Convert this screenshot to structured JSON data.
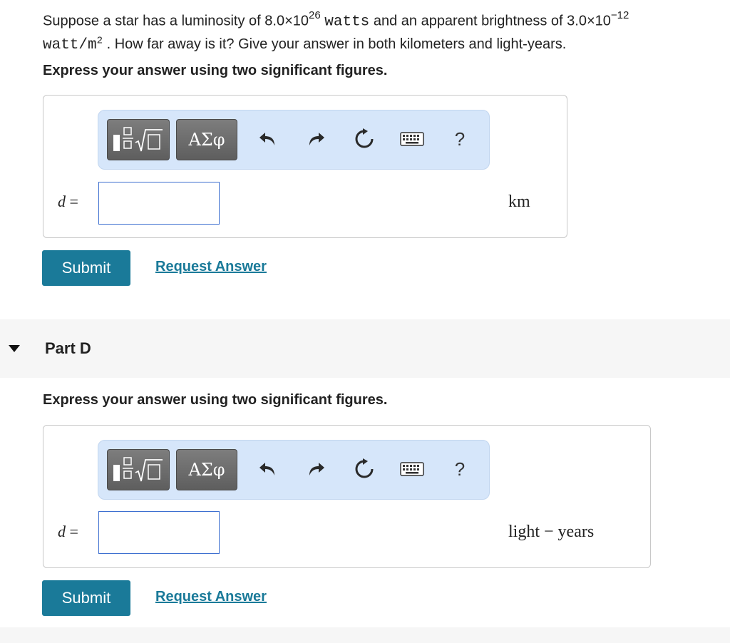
{
  "question": {
    "p1": "Suppose a star has a luminosity of 8.0×10",
    "exp1": "26",
    "unit1": "watts",
    "p2": " and an apparent brightness of 3.0×10",
    "exp2": "−12",
    "unit2": "watt/m",
    "unit2_exp": "2",
    "p3": " . How far away is it? Give your answer in both kilometers and light-years."
  },
  "part_c": {
    "instruction": "Express your answer using two significant figures.",
    "variable": "d",
    "equals": " =",
    "input_value": "",
    "unit": "km",
    "submit_label": "Submit",
    "request_label": "Request Answer"
  },
  "part_d": {
    "title": "Part D",
    "instruction": "Express your answer using two significant figures.",
    "variable": "d",
    "equals": " =",
    "input_value": "",
    "unit": "light − years",
    "submit_label": "Submit",
    "request_label": "Request Answer"
  },
  "toolbar": {
    "greek_label": "ΑΣφ",
    "help_label": "?",
    "icons": [
      "templates-icon",
      "greek-letters-icon",
      "undo-icon",
      "redo-icon",
      "reset-icon",
      "keyboard-icon",
      "help-icon"
    ]
  },
  "colors": {
    "submit_bg": "#1a7a99",
    "link": "#1a7a99",
    "toolbar_bg": "#d6e6fa",
    "input_border": "#3d6fd0",
    "band_bg": "#f6f6f6"
  }
}
